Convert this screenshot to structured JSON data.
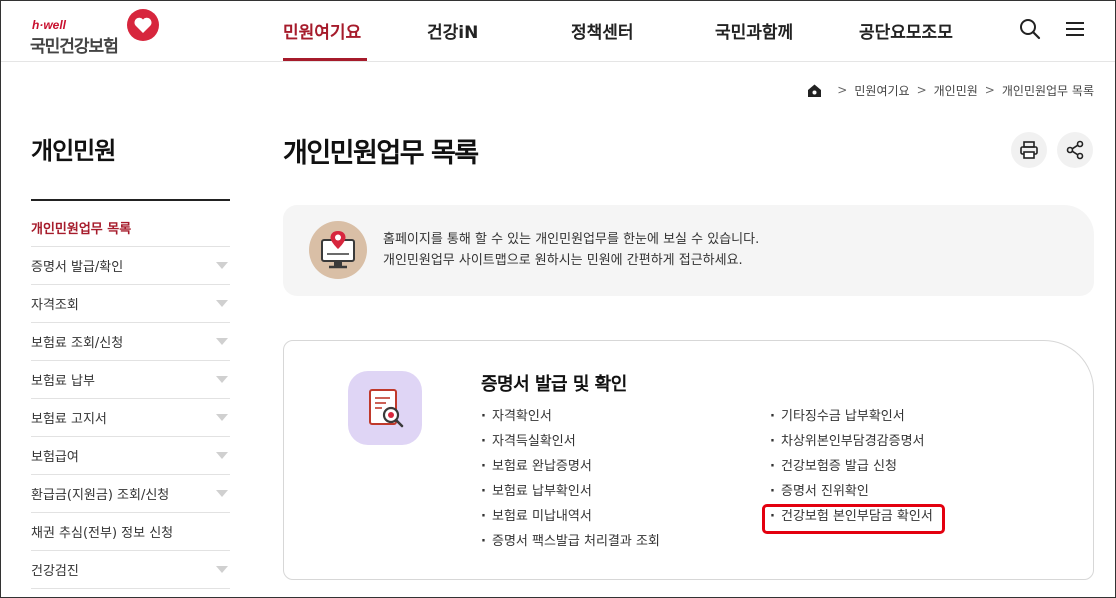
{
  "header": {
    "logo_small": "h·well",
    "logo_main": "국민건강보험",
    "nav": [
      "민원여기요",
      "건강iN",
      "정책센터",
      "국민과함께",
      "공단요모조모"
    ],
    "active_nav": "민원여기요",
    "icons": [
      "search-icon",
      "menu-icon"
    ],
    "accent_color": "#a61b2b"
  },
  "breadcrumb": {
    "home_icon": "home-icon",
    "items": [
      "민원여기요",
      "개인민원",
      "개인민원업무 목록"
    ]
  },
  "sidebar": {
    "title": "개인민원",
    "items": [
      {
        "label": "개인민원업무 목록",
        "active": true,
        "expandable": false
      },
      {
        "label": "증명서 발급/확인",
        "active": false,
        "expandable": true
      },
      {
        "label": "자격조회",
        "active": false,
        "expandable": true
      },
      {
        "label": "보험료 조회/신청",
        "active": false,
        "expandable": true
      },
      {
        "label": "보험료 납부",
        "active": false,
        "expandable": true
      },
      {
        "label": "보험료 고지서",
        "active": false,
        "expandable": true
      },
      {
        "label": "보험급여",
        "active": false,
        "expandable": true
      },
      {
        "label": "환급금(지원금) 조회/신청",
        "active": false,
        "expandable": true
      },
      {
        "label": "채권 추심(전부) 정보 신청",
        "active": false,
        "expandable": false
      },
      {
        "label": "건강검진",
        "active": false,
        "expandable": true
      }
    ]
  },
  "main": {
    "title": "개인민원업무 목록",
    "actions": [
      "print-icon",
      "share-icon"
    ],
    "info": {
      "icon": "monitor-location-icon",
      "lines": [
        "홈페이지를 통해 할 수 있는 개인민원업무를 한눈에 보실 수 있습니다.",
        "개인민원업무 사이트맵으로 원하시는 민원에 간편하게 접근하세요."
      ]
    },
    "section": {
      "icon": "certificate-search-icon",
      "title": "증명서 발급 및 확인",
      "left_items": [
        "자격확인서",
        "자격득실확인서",
        "보험료 완납증명서",
        "보험료 납부확인서",
        "보험료 미납내역서",
        "증명서 팩스발급 처리결과 조회"
      ],
      "right_items": [
        "기타징수금 납부확인서",
        "차상위본인부담경감증명서",
        "건강보험증 발급 신청",
        "증명서 진위확인",
        "건강보험 본인부담금 확인서"
      ],
      "highlighted_item": "건강보험 본인부담금 확인서",
      "highlight_color": "#e3000f"
    }
  }
}
